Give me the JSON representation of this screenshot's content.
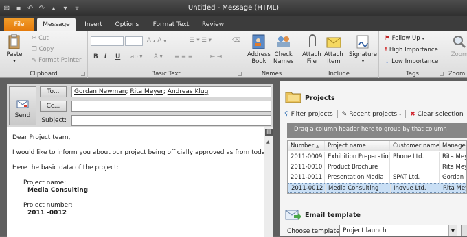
{
  "window": {
    "title": "Untitled - Message (HTML)"
  },
  "tabs": [
    "File",
    "Message",
    "Insert",
    "Options",
    "Format Text",
    "Review"
  ],
  "ribbon": {
    "clipboard": {
      "label": "Clipboard",
      "paste": "Paste",
      "cut": "Cut",
      "copy": "Copy",
      "format_painter": "Format Painter"
    },
    "basic_text": {
      "label": "Basic Text"
    },
    "names": {
      "label": "Names",
      "address_book": [
        "Address",
        "Book"
      ],
      "check_names": [
        "Check",
        "Names"
      ]
    },
    "include": {
      "label": "Include",
      "attach_file": [
        "Attach",
        "File"
      ],
      "attach_item": [
        "Attach",
        "Item"
      ],
      "signature": "Signature"
    },
    "tags": {
      "label": "Tags",
      "follow_up": "Follow Up",
      "high_importance": "High Importance",
      "low_importance": "Low Importance"
    },
    "zoom": {
      "label": "Zoom",
      "zoom": "Zoom"
    }
  },
  "compose": {
    "send": "Send",
    "to_button": "To...",
    "cc_button": "Cc...",
    "subject_label": "Subject:",
    "recipients": [
      {
        "name": "Gordan Newman",
        "sep": "; "
      },
      {
        "name": "Rita Meyer",
        "sep": "; "
      },
      {
        "name": "Andreas Klug",
        "sep": ""
      }
    ],
    "cc_value": "",
    "subject_value": "",
    "body": {
      "greeting": "Dear Project team,",
      "line1": "I would like to inform you about our project being officially approved as from today.",
      "line2": "Here the basic data of the project:",
      "name_label": "Project name:",
      "name_value": "Media Consulting",
      "number_label": "Project number:",
      "number_value": "2011 -0012"
    }
  },
  "projects": {
    "title": "Projects",
    "toolbar": {
      "filter": "Filter projects",
      "recent": "Recent projects",
      "clear": "Clear selection"
    },
    "group_hint": "Drag a column header here to group by that column",
    "columns": [
      "Number",
      "Project name",
      "Customer name",
      "Manager"
    ],
    "rows": [
      [
        "2011-0009",
        "Exhibition Preparation",
        "Phone Ltd.",
        "Rita Mey"
      ],
      [
        "2011-0010",
        "Product Brochure",
        "",
        "Rita Mey"
      ],
      [
        "2011-0011",
        "Presentation Media",
        "SPAT Ltd.",
        "Gordan N"
      ],
      [
        "2011-0012",
        "Media Consulting",
        "Inovue Ltd.",
        "Rita Mey"
      ]
    ],
    "selected_row": 3
  },
  "email_template": {
    "title": "Email template",
    "label": "Choose template",
    "value": "Project launch"
  }
}
